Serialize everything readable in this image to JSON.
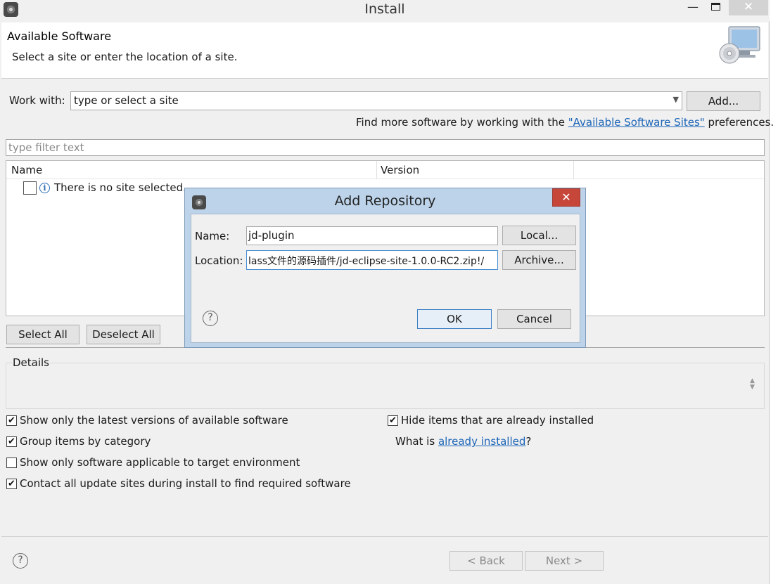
{
  "window": {
    "title": "Install",
    "min_glyph": "—",
    "close_glyph": "✕"
  },
  "header": {
    "title": "Available Software",
    "subtitle": "Select a site or enter the location of a site."
  },
  "work_with": {
    "label": "Work with:",
    "placeholder": "type or select a site",
    "add_label": "Add..."
  },
  "find_more": {
    "prefix": "Find more software by working with the ",
    "link": "\"Available Software Sites\"",
    "suffix": " preferences."
  },
  "filter": {
    "placeholder": "type filter text"
  },
  "table": {
    "columns": [
      "Name",
      "Version"
    ],
    "rows": [
      {
        "text": "There is no site selected."
      }
    ]
  },
  "buttons": {
    "select_all": "Select All",
    "deselect_all": "Deselect All",
    "back": "< Back",
    "next": "Next >"
  },
  "details": {
    "label": "Details"
  },
  "options": {
    "latest_versions": {
      "label": "Show only the latest versions of available software",
      "checked": true
    },
    "group_by_category": {
      "label": "Group items by category",
      "checked": true
    },
    "target_env": {
      "label": "Show only software applicable to target environment",
      "checked": false
    },
    "contact_sites": {
      "label": "Contact all update sites during install to find required software",
      "checked": true
    },
    "hide_installed": {
      "label": "Hide items that are already installed",
      "checked": true
    },
    "what_is_prefix": "What is ",
    "what_is_link": "already installed",
    "what_is_suffix": "?"
  },
  "dialog": {
    "title": "Add Repository",
    "close_glyph": "✕",
    "name_label": "Name:",
    "name_value": "jd-plugin",
    "local_label": "Local...",
    "location_label": "Location:",
    "location_value": "lass文件的源码插件/jd-eclipse-site-1.0.0-RC2.zip!/",
    "archive_label": "Archive...",
    "ok_label": "OK",
    "cancel_label": "Cancel"
  },
  "icons": {
    "help": "?",
    "info": "i",
    "check": "✔",
    "dropdown": "▼"
  }
}
